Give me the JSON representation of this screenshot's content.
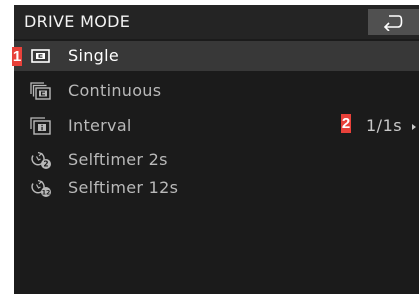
{
  "header": {
    "title": "DRIVE MODE",
    "back_icon": "back-arrow-icon"
  },
  "menu": {
    "items": [
      {
        "label": "Single",
        "icon": "single-frame-icon",
        "selected": true
      },
      {
        "label": "Continuous",
        "icon": "continuous-frames-icon",
        "selected": false
      },
      {
        "label": "Interval",
        "icon": "interval-icon",
        "value": "1/1s",
        "selected": false
      },
      {
        "label": "Selftimer 2s",
        "icon": "selftimer-2-icon",
        "selected": false
      },
      {
        "label": "Selftimer 12s",
        "icon": "selftimer-12-icon",
        "selected": false
      }
    ]
  },
  "markers": {
    "first": "1",
    "second": "2"
  },
  "colors": {
    "screen_bg": "#1b1b1b",
    "header_bg": "#242424",
    "selected_row": "#383838",
    "marker": "#e8413a"
  }
}
